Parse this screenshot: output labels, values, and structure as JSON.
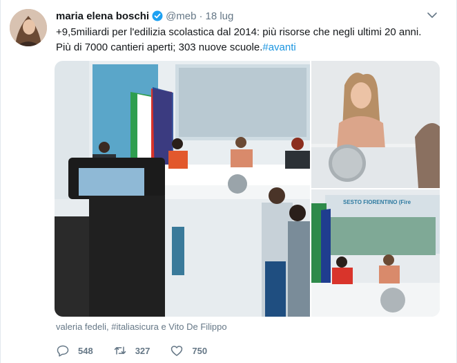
{
  "author": {
    "name": "maria elena boschi",
    "handle": "@meb",
    "separator": "·",
    "date": "18 lug"
  },
  "tweet": {
    "line1": "+9,5miliardi per l'edilizia scolastica dal 2014: più risorse che negli ultimi 20 anni.",
    "line2_text": "Più di 7000 cantieri aperti; 303 nuove scuole.",
    "hashtag": "#avanti"
  },
  "media": {
    "caption": "valeria fedeli, #italiasicura e Vito De Filippo",
    "screen_text": "SESTO FIORENTINO (Fire"
  },
  "actions": {
    "replies": "548",
    "retweets": "327",
    "likes": "750"
  },
  "colors": {
    "link": "#1b95e0",
    "verified": "#1da1f2",
    "secondary_text": "#657786",
    "primary_text": "#14171a"
  },
  "icons": [
    "verified-badge-icon",
    "chevron-down-icon",
    "reply-icon",
    "retweet-icon",
    "like-icon"
  ]
}
